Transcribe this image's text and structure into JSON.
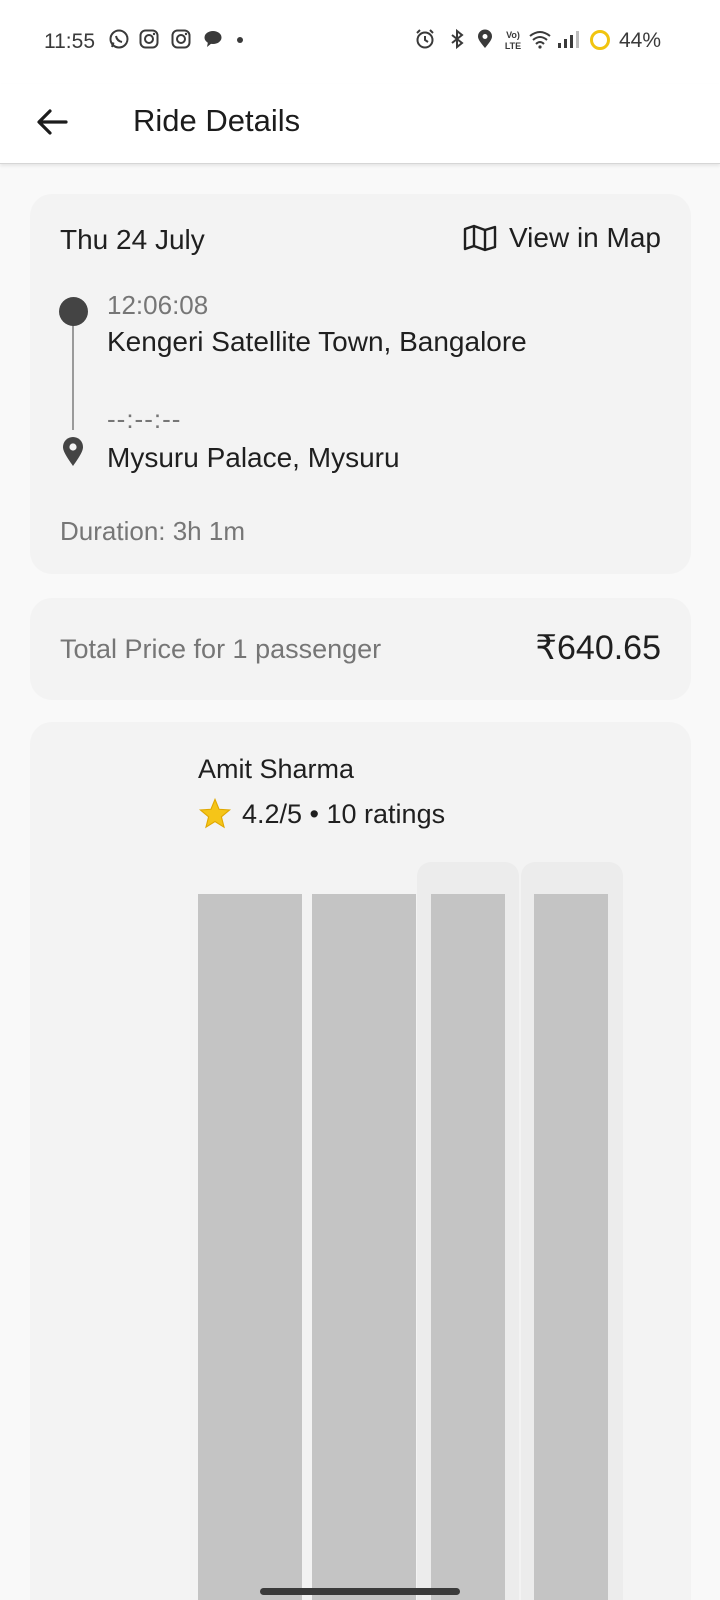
{
  "status_bar": {
    "time": "11:55",
    "battery": "44%",
    "left_icons": [
      "whatsapp-icon",
      "instagram-icon",
      "instagram-icon",
      "chat-icon",
      "dot-icon"
    ],
    "right_icons": [
      "alarm-icon",
      "bluetooth-icon",
      "location-icon",
      "volte-icon",
      "wifi-icon",
      "signal-icon",
      "battery-saver-icon"
    ]
  },
  "app_bar": {
    "title": "Ride Details",
    "back_icon": "arrow-left-icon"
  },
  "trip": {
    "date": "Thu 24 July",
    "map_link_label": "View in Map",
    "map_icon": "map-icon",
    "pickup": {
      "time": "12:06:08",
      "place": "Kengeri Satellite Town, Bangalore"
    },
    "drop": {
      "time": "--:--:--",
      "place": "Mysuru Palace, Mysuru"
    },
    "duration": "Duration: 3h 1m"
  },
  "price": {
    "label": "Total Price for 1 passenger",
    "value": "₹640.65"
  },
  "driver": {
    "name": "Amit Sharma",
    "rating_icon": "star-icon",
    "rating_text": "4.2/5 • 10 ratings"
  },
  "colors": {
    "accent_star": "#f5c518",
    "card_bg": "#f3f3f3",
    "skeleton": "#c4c4c4",
    "battery_ring": "#f1c40f"
  }
}
